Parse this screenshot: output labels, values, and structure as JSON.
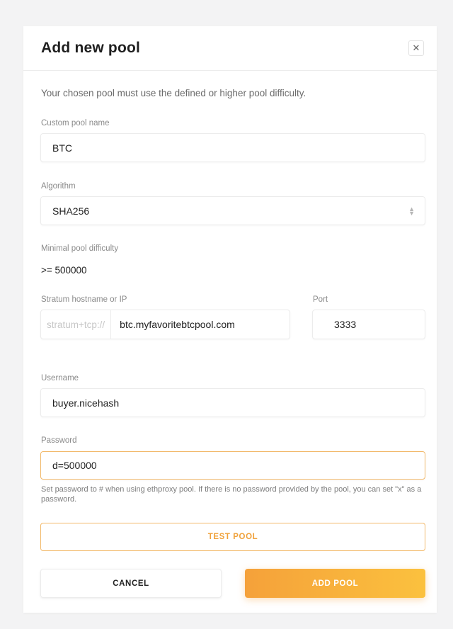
{
  "dialog": {
    "title": "Add new pool",
    "close_icon": "close-icon",
    "intro": "Your chosen pool must use the defined or higher pool difficulty."
  },
  "form": {
    "pool_name": {
      "label": "Custom pool name",
      "value": "BTC"
    },
    "algorithm": {
      "label": "Algorithm",
      "value": "SHA256",
      "icon": "select-arrows-icon"
    },
    "difficulty": {
      "label": "Minimal pool difficulty",
      "value": ">= 500000"
    },
    "stratum": {
      "label": "Stratum hostname or IP",
      "prefix": "stratum+tcp://",
      "value": "btc.myfavoritebtcpool.com"
    },
    "port": {
      "label": "Port",
      "value": "3333"
    },
    "username": {
      "label": "Username",
      "value": "buyer.nicehash"
    },
    "password": {
      "label": "Password",
      "value": "d=500000",
      "hint": "Set password to # when using ethproxy pool. If there is no password provided by the pool, you can set \"x\" as a password."
    }
  },
  "actions": {
    "test_label": "TEST POOL",
    "cancel_label": "CANCEL",
    "add_label": "ADD POOL"
  },
  "colors": {
    "accent": "#f5a13a",
    "accent_end": "#fbc13e",
    "background": "#f3f3f4"
  }
}
